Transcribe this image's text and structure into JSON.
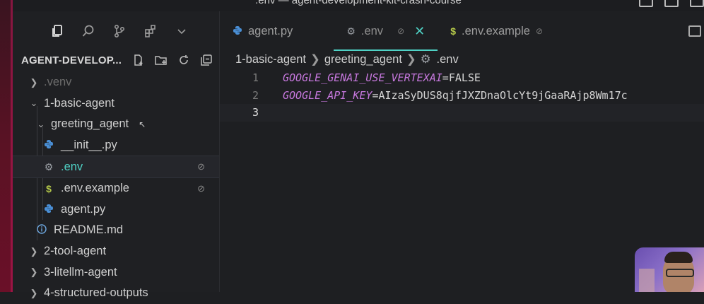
{
  "window": {
    "title": ".env — agent-development-kit-crash-course"
  },
  "sidebar": {
    "explorer_title": "AGENT-DEVELOP...",
    "tree": [
      {
        "label": ".venv",
        "level": 0,
        "type": "folder",
        "expanded": false,
        "dim": true
      },
      {
        "label": "1-basic-agent",
        "level": 0,
        "type": "folder",
        "expanded": true
      },
      {
        "label": "greeting_agent",
        "level": 1,
        "type": "folder",
        "expanded": true
      },
      {
        "label": "__init__.py",
        "level": 2,
        "type": "python"
      },
      {
        "label": ".env",
        "level": 2,
        "type": "env",
        "selected": true,
        "badge": "⊘"
      },
      {
        "label": ".env.example",
        "level": 2,
        "type": "dollar",
        "badge": "⊘"
      },
      {
        "label": "agent.py",
        "level": 2,
        "type": "python"
      },
      {
        "label": "README.md",
        "level": 1,
        "type": "info"
      },
      {
        "label": "2-tool-agent",
        "level": 0,
        "type": "folder",
        "expanded": false
      },
      {
        "label": "3-litellm-agent",
        "level": 0,
        "type": "folder",
        "expanded": false
      },
      {
        "label": "4-structured-outputs",
        "level": 0,
        "type": "folder",
        "expanded": false
      }
    ]
  },
  "tabs": [
    {
      "label": "agent.py",
      "icon": "python-icon"
    },
    {
      "label": ".env",
      "icon": "gear-icon",
      "active": true
    },
    {
      "label": ".env.example",
      "icon": "dollar-icon"
    }
  ],
  "breadcrumb": {
    "part1": "1-basic-agent",
    "part2": "greeting_agent",
    "part3": ".env"
  },
  "code": [
    {
      "num": "1",
      "key": "GOOGLE_GENAI_USE_VERTEXAI",
      "value": "FALSE"
    },
    {
      "num": "2",
      "key": "GOOGLE_API_KEY",
      "value": "AIzaSyDUS8qjfJXZDnaOlcYt9jGaaRAjp8Wm17c"
    },
    {
      "num": "3",
      "key": "",
      "value": ""
    }
  ],
  "colors": {
    "accent": "#4fd1c5",
    "env_key": "#c678dd",
    "python": "#4a8fd6"
  }
}
